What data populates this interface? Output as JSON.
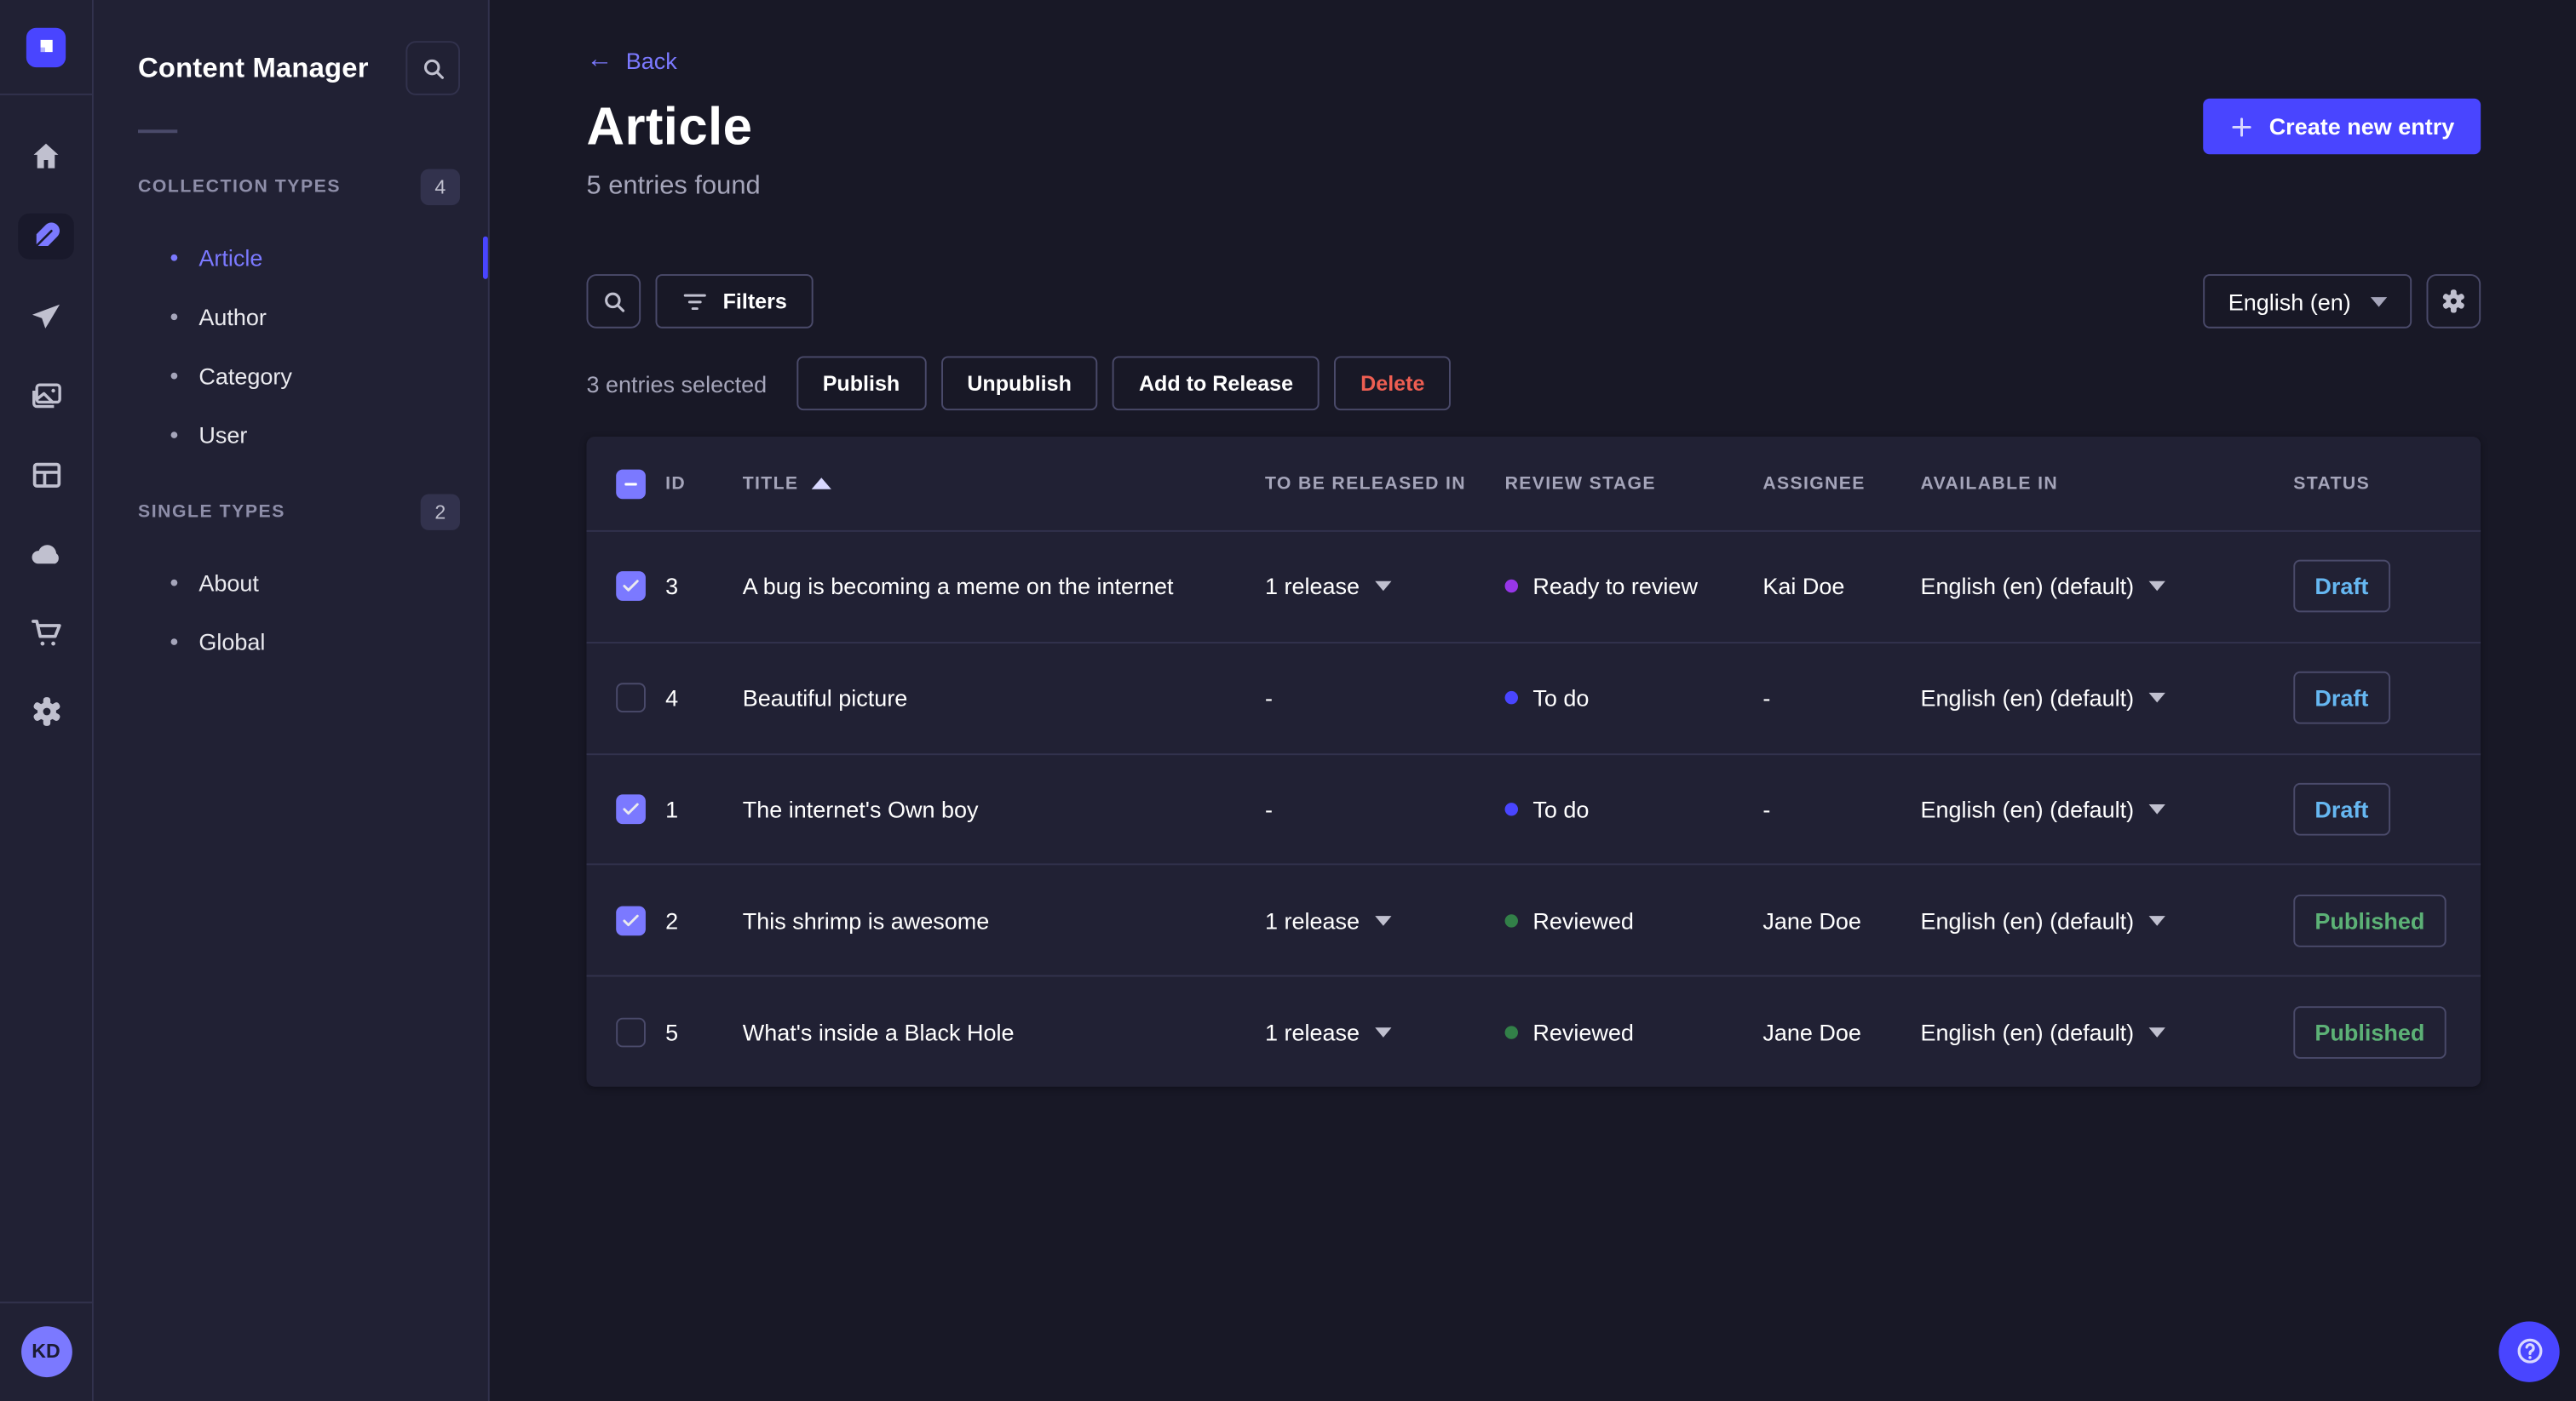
{
  "colors": {
    "accent": "#4945ff",
    "checkbox": "#7b79ff",
    "draft_text": "#66b7f1",
    "published_text": "#5cb176",
    "danger": "#ee5e52",
    "stage_ready": "#9736e8",
    "stage_todo": "#4945ff",
    "stage_reviewed": "#328048"
  },
  "nav_rail": {
    "icons": [
      "home-icon",
      "feather-icon",
      "paper-plane-icon",
      "media-images-icon",
      "layout-icon",
      "cloud-icon",
      "cart-icon",
      "gear-icon"
    ],
    "active_icon": "feather-icon",
    "avatar_initials": "KD"
  },
  "sidebar": {
    "title": "Content Manager",
    "search_icon": "search-icon",
    "sections": [
      {
        "label": "COLLECTION TYPES",
        "badge": "4",
        "items": [
          {
            "label": "Article",
            "active": true
          },
          {
            "label": "Author",
            "active": false
          },
          {
            "label": "Category",
            "active": false
          },
          {
            "label": "User",
            "active": false
          }
        ]
      },
      {
        "label": "SINGLE TYPES",
        "badge": "2",
        "items": [
          {
            "label": "About",
            "active": false
          },
          {
            "label": "Global",
            "active": false
          }
        ]
      }
    ]
  },
  "header": {
    "back_label": "Back",
    "title": "Article",
    "subtitle": "5 entries found",
    "create_button_label": "Create new entry"
  },
  "toolbar": {
    "filters_label": "Filters",
    "locale_selected": "English (en)"
  },
  "selection": {
    "text": "3 entries selected",
    "publish_label": "Publish",
    "unpublish_label": "Unpublish",
    "add_to_release_label": "Add to Release",
    "delete_label": "Delete"
  },
  "table": {
    "columns": [
      "ID",
      "TITLE",
      "TO BE RELEASED IN",
      "REVIEW STAGE",
      "ASSIGNEE",
      "AVAILABLE IN",
      "STATUS"
    ],
    "sorted_column": "TITLE",
    "sort_direction": "ascending",
    "header_checkbox_state": "indeterminate",
    "rows": [
      {
        "checked": true,
        "id": "3",
        "title": "A bug is becoming a meme on the internet",
        "release": "1 release",
        "stage": "Ready to review",
        "stage_color": "#9736e8",
        "assignee": "Kai Doe",
        "available_in": "English (en) (default)",
        "status": "Draft",
        "status_color": "#66b7f1"
      },
      {
        "checked": false,
        "id": "4",
        "title": "Beautiful picture",
        "release": "-",
        "stage": "To do",
        "stage_color": "#4945ff",
        "assignee": "-",
        "available_in": "English (en) (default)",
        "status": "Draft",
        "status_color": "#66b7f1"
      },
      {
        "checked": true,
        "id": "1",
        "title": "The internet's Own boy",
        "release": "-",
        "stage": "To do",
        "stage_color": "#4945ff",
        "assignee": "-",
        "available_in": "English (en) (default)",
        "status": "Draft",
        "status_color": "#66b7f1"
      },
      {
        "checked": true,
        "id": "2",
        "title": "This shrimp is awesome",
        "release": "1 release",
        "stage": "Reviewed",
        "stage_color": "#328048",
        "assignee": "Jane Doe",
        "available_in": "English (en) (default)",
        "status": "Published",
        "status_color": "#5cb176"
      },
      {
        "checked": false,
        "id": "5",
        "title": "What's inside a Black Hole",
        "release": "1 release",
        "stage": "Reviewed",
        "stage_color": "#328048",
        "assignee": "Jane Doe",
        "available_in": "English (en) (default)",
        "status": "Published",
        "status_color": "#5cb176"
      }
    ]
  },
  "help": {
    "icon": "question-circle-icon"
  }
}
